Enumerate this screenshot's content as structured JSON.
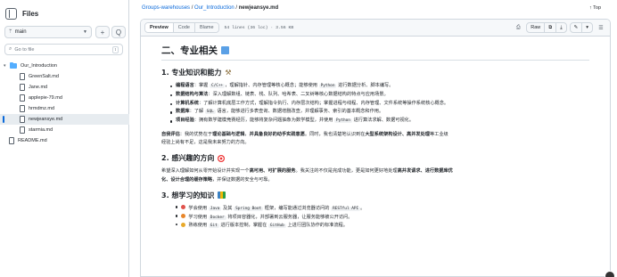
{
  "sidebar": {
    "title": "Files",
    "branch": "main",
    "add_label": "+",
    "search_label": "Q",
    "go_to_file_placeholder": "Go to file",
    "go_to_file_kbd": "t",
    "folder": "Our_Introduction",
    "files": [
      "GreenSalt.md",
      "Jane.md",
      "applepie-79.md",
      "hrmdmz.md",
      "newjeansye.md",
      "starmia.md"
    ],
    "selected_file": "newjeansye.md",
    "root_files": [
      "README.md"
    ]
  },
  "breadcrumb": {
    "repo": "Groups-warehouses",
    "sep1": "/",
    "folder": "Our_Introduction",
    "sep2": "/",
    "file": "newjeansye.md"
  },
  "top_link": "↑ Top",
  "toolbar": {
    "tabs": [
      "Preview",
      "Code",
      "Blame"
    ],
    "active_tab": "Preview",
    "meta": "54 lines (36 loc) · 3.56 KB",
    "raw_label": "Raw"
  },
  "doc": {
    "h2": "二、专业相关",
    "s1_title": "1. 专业知识和能力",
    "s1_items": [
      {
        "term": "编程语言",
        "pre": "：掌握 ",
        "code1": "C/C++",
        "mid": "，理解指针、内存管理等核心概念；能够使用 ",
        "code2": "Python",
        "post": " 进行数据分析、脚本编写。"
      },
      {
        "term": "数据结构与算法",
        "pre": "：深入理解数组、链表、栈、队列、哈希表、二叉树等核心数据结构的特点与应用场景。",
        "code1": "",
        "mid": "",
        "code2": "",
        "post": ""
      },
      {
        "term": "计算机系统",
        "pre": "：了解计算机底层工作方式，理解指令执行、内存层次结构；掌握进程与线程、内存管理、文件系统等操作系统核心概念。",
        "code1": "",
        "mid": "",
        "code2": "",
        "post": ""
      },
      {
        "term": "数据库",
        "pre": "：了解 ",
        "code1": "SQL",
        "mid": " 语言，能够进行多表查询、数据增删改查，并理解事务、索引的基本概念和作用。",
        "code2": "",
        "post": ""
      },
      {
        "term": "项目经验",
        "pre": "：拥有数学建模竞赛经历，能够将复杂问题抽象为数学模型，并使用 ",
        "code1": "Python",
        "mid": " 进行算法求解、数据可视化。",
        "code2": "",
        "post": ""
      }
    ],
    "self_eval": {
      "label": "自我评估",
      "t1": "：我的优势在于",
      "b1": "理论基础与逻辑",
      "t2": "，",
      "b2": "并具备良好的动手实践意愿",
      "t3": "。同时，我也清楚地认识到在",
      "b3": "大型系统架构设计、高并发处理",
      "t4": "等工业级",
      "line2": "经验上尚有不足，这是我未来努力的方向。"
    },
    "s2_title": "2. 感兴趣的方向",
    "s2_para": {
      "t1": "希望深入理解如何从零开始设计并实现一个",
      "b1": "高可用、可扩展的服务",
      "t2": "。我关注的不仅是完成功能，更是如何更好地处理",
      "b2": "高并发请求、进行数据库优",
      "line2b": "化、设计合理的缓存策略",
      "line2t": "，并保证数据的安全与可靠。"
    },
    "s3_title": "3. 想学习的知识",
    "s3_items": [
      {
        "pre": "学会使用 ",
        "code1": "Java",
        "mid": " 及其 ",
        "code2": "Spring Boot",
        "mid2": " 框架，编写能通过浏览器访问的 ",
        "code3": "RESTful API",
        "post": "。",
        "dot": "#e0524b"
      },
      {
        "pre": "学习使用 ",
        "code1": "Docker",
        "mid": " 将项目容器化，并部署到云服务器，让服务能够被公开访问。",
        "code2": "",
        "mid2": "",
        "code3": "",
        "post": "",
        "dot": "#e8862a"
      },
      {
        "pre": "熟练使用 ",
        "code1": "Git",
        "mid": " 进行版本控制，掌握在 ",
        "code2": "GitHub",
        "mid2": " 上进行团队协作的标准流程。",
        "code3": "",
        "post": "",
        "dot": "#e8a92a"
      }
    ]
  }
}
